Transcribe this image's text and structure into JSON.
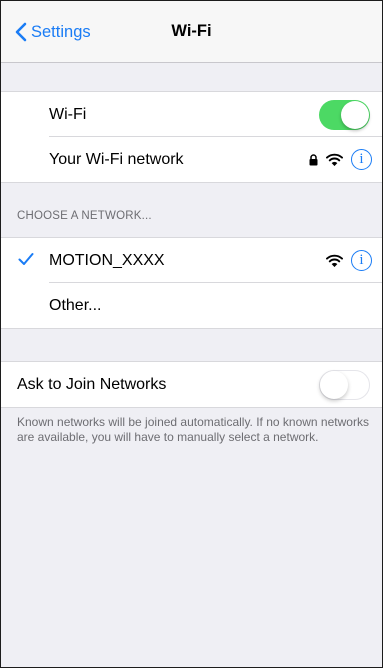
{
  "navbar": {
    "back_label": "Settings",
    "title": "Wi-Fi"
  },
  "wifi_group": {
    "wifi_label": "Wi-Fi",
    "wifi_enabled": true,
    "current_network": "Your Wi-Fi network"
  },
  "choose_section": {
    "header": "CHOOSE A NETWORK...",
    "networks": [
      {
        "name": "MOTION_XXXX",
        "selected": true
      },
      {
        "name": "Other..."
      }
    ]
  },
  "ask_join": {
    "label": "Ask to Join Networks",
    "enabled": false,
    "footer": "Known networks will be joined automatically. If no known networks are available, you will have to manually select a network."
  },
  "colors": {
    "accent": "#1a7cf5",
    "switch_on": "#4cd964",
    "background": "#efeff4"
  },
  "icons": {
    "back": "chevron-left-icon",
    "lock": "lock-icon",
    "wifi": "wifi-signal-icon",
    "info": "info-icon",
    "check": "checkmark-icon"
  },
  "info_glyph": "i"
}
